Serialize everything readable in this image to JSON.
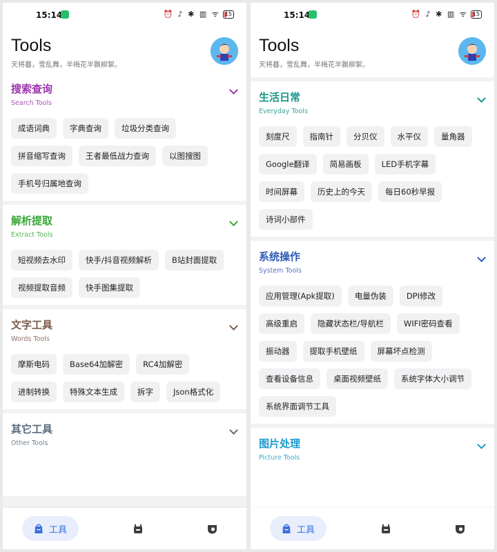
{
  "colors": {
    "purple": "#9b35ae",
    "green": "#3aa53a",
    "brown": "#7b5a4a",
    "slate": "#5a6b7a",
    "teal": "#16968a",
    "blue": "#2f5bb8",
    "cyan": "#1a9bd0",
    "accent": "#3a6fe0"
  },
  "status": {
    "time": "15:14",
    "battery": "15",
    "icons": "⏰ ♪ ✱ ▥ ᯤ"
  },
  "header": {
    "title": "Tools",
    "subtitle": "天将暮，雪乱舞，半梅花半飘柳絮。"
  },
  "nav": {
    "tools_label": "工具",
    "icons": [
      "toolbox-icon",
      "robot-icon",
      "shield-icon"
    ]
  },
  "left": {
    "sections": [
      {
        "title": "搜索查询",
        "subtitle": "Search Tools",
        "color": "#9b35ae",
        "items": [
          "成语词典",
          "字典查询",
          "垃圾分类查询",
          "拼音缩写查询",
          "王者最低战力查询",
          "以图搜图",
          "手机号归属地查询"
        ]
      },
      {
        "title": "解析提取",
        "subtitle": "Extract Tools",
        "color": "#3aa53a",
        "items": [
          "短视频去水印",
          "快手/抖音视频解析",
          "B站封面提取",
          "视频提取音频",
          "快手图集提取"
        ]
      },
      {
        "title": "文字工具",
        "subtitle": "Words Tools",
        "color": "#7b5a4a",
        "items": [
          "摩斯电码",
          "Base64加解密",
          "RC4加解密",
          "进制转换",
          "特殊文本生成",
          "拆字",
          "Json格式化"
        ]
      },
      {
        "title": "其它工具",
        "subtitle": "Other Tools",
        "color": "#5a6b7a",
        "items": []
      }
    ]
  },
  "right": {
    "sections": [
      {
        "title": "生活日常",
        "subtitle": "Everyday Tools",
        "color": "#16968a",
        "items": [
          "刻度尺",
          "指南针",
          "分贝仪",
          "水平仪",
          "量角器",
          "Google翻译",
          "简易画板",
          "LED手机字幕",
          "时间屏幕",
          "历史上的今天",
          "每日60秒早报",
          "诗词小部件"
        ]
      },
      {
        "title": "系统操作",
        "subtitle": "System Tools",
        "color": "#2f5bb8",
        "items": [
          "应用管理(Apk提取)",
          "电量伪装",
          "DPI修改",
          "高级重启",
          "隐藏状态栏/导航栏",
          "WIFI密码查看",
          "振动器",
          "提取手机壁纸",
          "屏幕坏点检测",
          "查看设备信息",
          "桌面视频壁纸",
          "系统字体大小调节",
          "系统界面调节工具"
        ]
      },
      {
        "title": "图片处理",
        "subtitle": "Picture Tools",
        "color": "#1a9bd0",
        "items": []
      }
    ]
  }
}
